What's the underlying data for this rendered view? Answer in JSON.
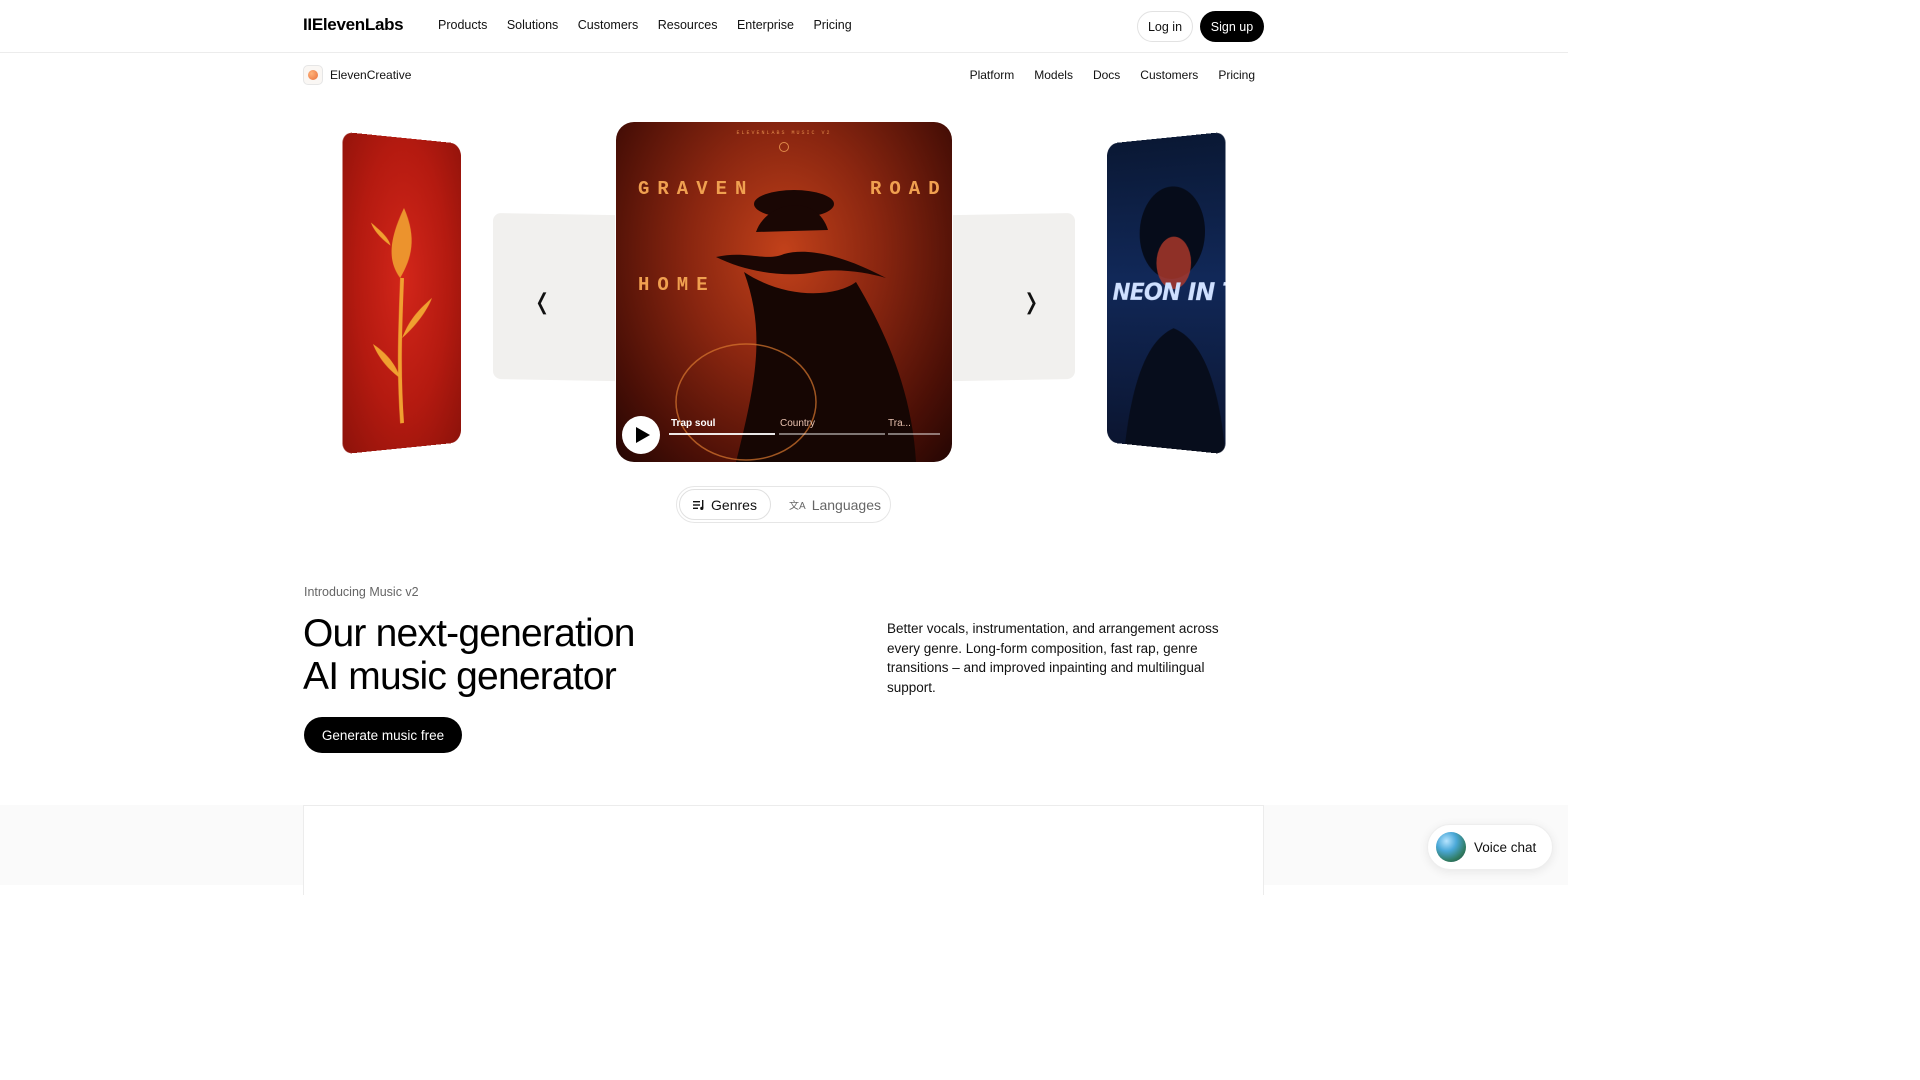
{
  "topnav": {
    "logo": "IIElevenLabs",
    "links": [
      "Products",
      "Solutions",
      "Customers",
      "Resources",
      "Enterprise",
      "Pricing"
    ],
    "login_label": "Log in",
    "signup_label": "Sign up"
  },
  "subnav": {
    "brand": "ElevenCreative",
    "links": [
      "Platform",
      "Models",
      "Docs",
      "Customers",
      "Pricing"
    ]
  },
  "carousel": {
    "prev_icon": "chevron-left-icon",
    "next_icon": "chevron-right-icon",
    "left_card": {
      "color": "#c21f14"
    },
    "right_card": {
      "title": "NEON IN THE NIGHT",
      "color": "#112858"
    },
    "main_card": {
      "brand_line": "ELEVENLABS MUSIC V2",
      "words": {
        "w1": "GRAVEN",
        "w2": "ROAD",
        "w3": "HOME"
      },
      "genres": [
        "Trap soul",
        "Country",
        "Tra..."
      ],
      "active_genre_progress": 1.0,
      "play_icon": "play-icon"
    }
  },
  "toggle": {
    "genres_label": "Genres",
    "languages_label": "Languages"
  },
  "hero": {
    "intro": "Introducing Music v2",
    "headline_line1": "Our next-generation",
    "headline_line2": "AI music generator",
    "description": "Better vocals, instrumentation, and arrangement across every genre. Long-form composition, fast rap, genre transitions – and improved inpainting and multilingual support.",
    "cta_label": "Generate music free"
  },
  "voice_chat": {
    "label": "Voice chat",
    "icon": "orb-icon"
  },
  "colors": {
    "accent": "#000000",
    "panel": "#f1f0ee"
  }
}
